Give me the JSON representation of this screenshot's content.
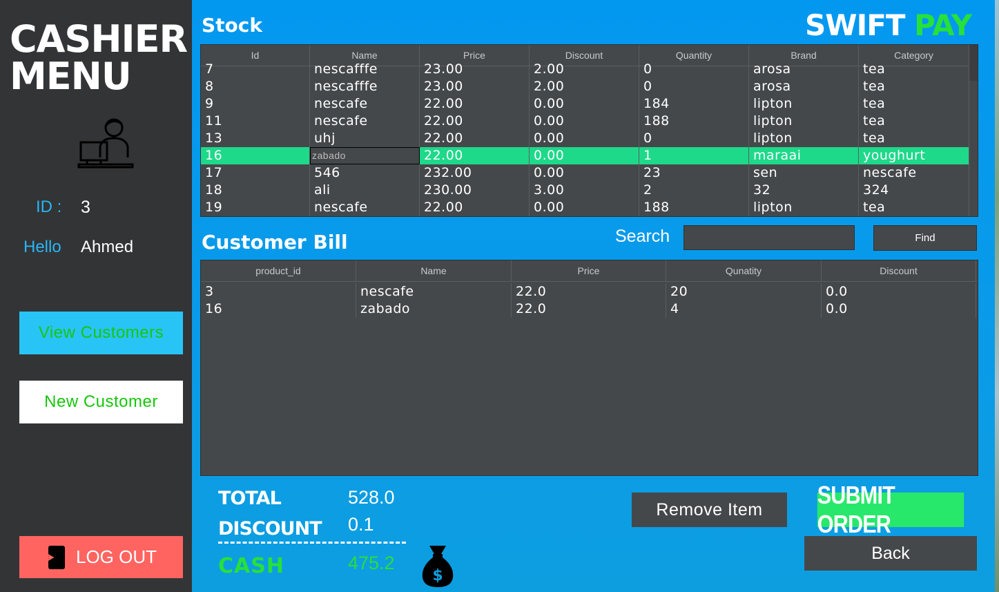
{
  "sidebar": {
    "title_line1": "CASHIER",
    "title_line2": "MENU",
    "id_label": "ID :",
    "id_value": "3",
    "hello_label": "Hello",
    "hello_value": "Ahmed",
    "view_customers": "View Customers",
    "new_customer": "New Customer",
    "logout": "LOG OUT"
  },
  "logo": {
    "part1": "SWIFT",
    "part2": "PAY"
  },
  "stock": {
    "title": "Stock",
    "columns": [
      "Id",
      "Name",
      "Price",
      "Discount",
      "Quantity",
      "Brand",
      "Category"
    ],
    "rows": [
      [
        "7",
        "nescafffe",
        "23.00",
        "2.00",
        "0",
        "arosa",
        "tea"
      ],
      [
        "8",
        "nescafffe",
        "23.00",
        "2.00",
        "0",
        "arosa",
        "tea"
      ],
      [
        "9",
        "nescafe",
        "22.00",
        "0.00",
        "184",
        "lipton",
        "tea"
      ],
      [
        "11",
        "nescafe",
        "22.00",
        "0.00",
        "188",
        "lipton",
        "tea"
      ],
      [
        "13",
        "uhj",
        "22.00",
        "0.00",
        "0",
        "lipton",
        "tea"
      ],
      [
        "16",
        "zabado",
        "22.00",
        "0.00",
        "1",
        "maraai",
        "youghurt"
      ],
      [
        "17",
        "546",
        "232.00",
        "0.00",
        "23",
        "sen",
        "nescafe"
      ],
      [
        "18",
        "ali",
        "230.00",
        "3.00",
        "2",
        "32",
        "324"
      ],
      [
        "19",
        "nescafe",
        "22.00",
        "0.00",
        "188",
        "lipton",
        "tea"
      ]
    ],
    "selected_row": 5
  },
  "bill": {
    "title": "Customer Bill",
    "columns": [
      "product_id",
      "Name",
      "Price",
      "Qunatity",
      "Discount"
    ],
    "rows": [
      [
        "3",
        "nescafe",
        "22.0",
        "20",
        "0.0"
      ],
      [
        "16",
        "zabado",
        "22.0",
        "4",
        "0.0"
      ]
    ]
  },
  "search": {
    "label": "Search",
    "value": "",
    "find": "Find"
  },
  "summary": {
    "total_label": "TOTAL",
    "total_value": "528.0",
    "discount_label": "DISCOUNT",
    "discount_value": "0.1",
    "cash_label": "CASH",
    "cash_value": "475.2"
  },
  "actions": {
    "remove": "Remove Item",
    "submit": "SUBMIT ORDER",
    "back": "Back"
  },
  "colors": {
    "accent": "#0398f0",
    "green": "#27e03a",
    "selected": "#1ed98a",
    "logout": "#ff6461"
  }
}
